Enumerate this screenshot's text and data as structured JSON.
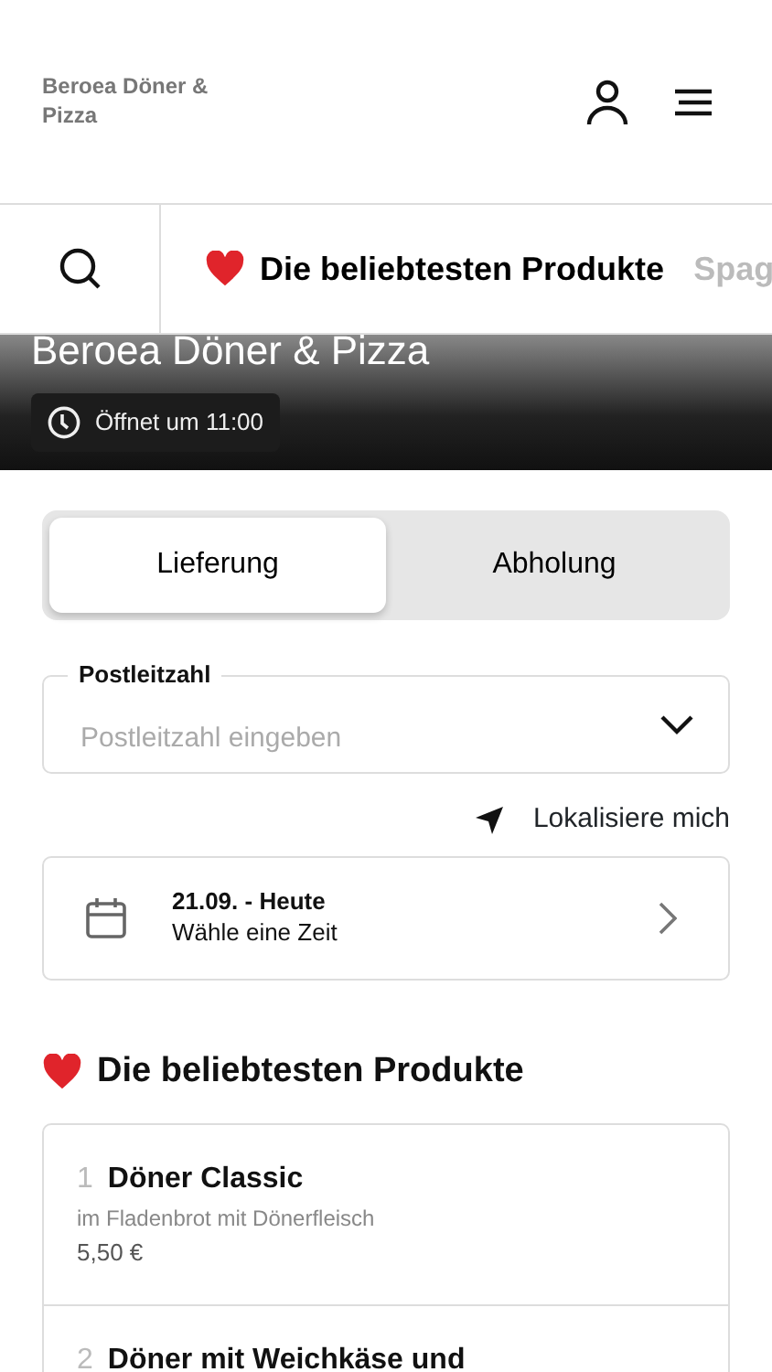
{
  "header": {
    "brand": "Beroea Döner & Pizza"
  },
  "categories": [
    {
      "label": "Die beliebtesten Produkte",
      "selected": true,
      "heart": true
    },
    {
      "label": "Spag",
      "selected": false,
      "heart": false
    }
  ],
  "hero": {
    "title": "Beroea Döner & Pizza",
    "hours": "Öffnet um 11:00"
  },
  "mode_tabs": [
    {
      "label": "Lieferung",
      "selected": true
    },
    {
      "label": "Abholung",
      "selected": false
    }
  ],
  "postcode": {
    "label": "Postleitzahl",
    "placeholder": "Postleitzahl eingeben"
  },
  "locate": "Lokalisiere mich",
  "date": {
    "title": "21.09. - Heute",
    "subtitle": "Wähle eine Zeit"
  },
  "section_title": "Die beliebtesten Produkte",
  "products": [
    {
      "rank": "1",
      "name": "Döner Classic",
      "description": "im Fladenbrot mit Dönerfleisch",
      "price": "5,50 €"
    },
    {
      "rank": "2",
      "name": "Döner mit Weichkäse und"
    }
  ]
}
